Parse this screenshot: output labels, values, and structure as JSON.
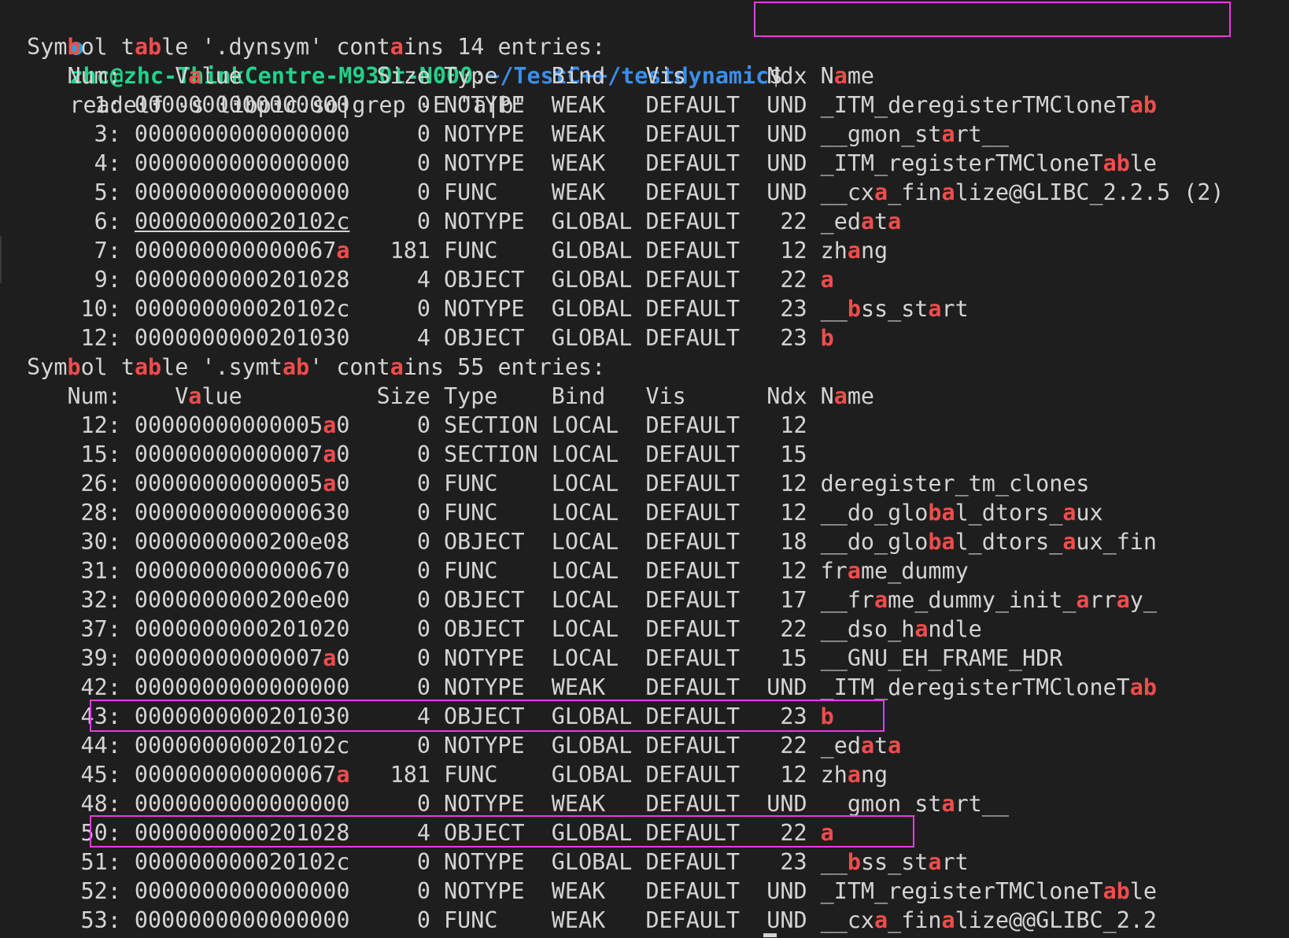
{
  "prompt": {
    "user_host": "zhc@zhc-ThinkCentre-M930t-N000",
    "path": "~/TestC++/testdynamic",
    "symbol": "$",
    "command": "readelf -s libpic.so|grep -E \"a|b\""
  },
  "dynsym": {
    "header": "Symbol table '.dynsym' contains 14 entries:",
    "columns": [
      "Num:",
      "Value",
      "Size",
      "Type",
      "Bind",
      "Vis",
      "Ndx",
      "Name"
    ],
    "rows": [
      [
        "1:",
        "0000000000000000",
        "0",
        "NOTYPE",
        "WEAK",
        "DEFAULT",
        "UND",
        "_ITM_deregisterTMCloneTab"
      ],
      [
        "3:",
        "0000000000000000",
        "0",
        "NOTYPE",
        "WEAK",
        "DEFAULT",
        "UND",
        "__gmon_start__"
      ],
      [
        "4:",
        "0000000000000000",
        "0",
        "NOTYPE",
        "WEAK",
        "DEFAULT",
        "UND",
        "_ITM_registerTMCloneTable"
      ],
      [
        "5:",
        "0000000000000000",
        "0",
        "FUNC",
        "WEAK",
        "DEFAULT",
        "UND",
        "__cxa_finalize@GLIBC_2.2.5 (2)"
      ],
      [
        "6:",
        "000000000020102c",
        "0",
        "NOTYPE",
        "GLOBAL",
        "DEFAULT",
        "22",
        "_edata"
      ],
      [
        "7:",
        "000000000000067a",
        "181",
        "FUNC",
        "GLOBAL",
        "DEFAULT",
        "12",
        "zhang"
      ],
      [
        "9:",
        "0000000000201028",
        "4",
        "OBJECT",
        "GLOBAL",
        "DEFAULT",
        "22",
        "a"
      ],
      [
        "10:",
        "000000000020102c",
        "0",
        "NOTYPE",
        "GLOBAL",
        "DEFAULT",
        "23",
        "__bss_start"
      ],
      [
        "12:",
        "0000000000201030",
        "4",
        "OBJECT",
        "GLOBAL",
        "DEFAULT",
        "23",
        "b"
      ]
    ]
  },
  "symtab": {
    "header": "Symbol table '.symtab' contains 55 entries:",
    "columns": [
      "Num:",
      "Value",
      "Size",
      "Type",
      "Bind",
      "Vis",
      "Ndx",
      "Name"
    ],
    "rows": [
      [
        "12:",
        "00000000000005a0",
        "0",
        "SECTION",
        "LOCAL",
        "DEFAULT",
        "12",
        ""
      ],
      [
        "15:",
        "00000000000007a0",
        "0",
        "SECTION",
        "LOCAL",
        "DEFAULT",
        "15",
        ""
      ],
      [
        "26:",
        "00000000000005a0",
        "0",
        "FUNC",
        "LOCAL",
        "DEFAULT",
        "12",
        "deregister_tm_clones"
      ],
      [
        "28:",
        "0000000000000630",
        "0",
        "FUNC",
        "LOCAL",
        "DEFAULT",
        "12",
        "__do_global_dtors_aux"
      ],
      [
        "30:",
        "0000000000200e08",
        "0",
        "OBJECT",
        "LOCAL",
        "DEFAULT",
        "18",
        "__do_global_dtors_aux_fin"
      ],
      [
        "31:",
        "0000000000000670",
        "0",
        "FUNC",
        "LOCAL",
        "DEFAULT",
        "12",
        "frame_dummy"
      ],
      [
        "32:",
        "0000000000200e00",
        "0",
        "OBJECT",
        "LOCAL",
        "DEFAULT",
        "17",
        "__frame_dummy_init_array_"
      ],
      [
        "37:",
        "0000000000201020",
        "0",
        "OBJECT",
        "LOCAL",
        "DEFAULT",
        "22",
        "__dso_handle"
      ],
      [
        "39:",
        "00000000000007a0",
        "0",
        "NOTYPE",
        "LOCAL",
        "DEFAULT",
        "15",
        "__GNU_EH_FRAME_HDR"
      ],
      [
        "42:",
        "0000000000000000",
        "0",
        "NOTYPE",
        "WEAK",
        "DEFAULT",
        "UND",
        "_ITM_deregisterTMCloneTab"
      ],
      [
        "43:",
        "0000000000201030",
        "4",
        "OBJECT",
        "GLOBAL",
        "DEFAULT",
        "23",
        "b"
      ],
      [
        "44:",
        "000000000020102c",
        "0",
        "NOTYPE",
        "GLOBAL",
        "DEFAULT",
        "22",
        "_edata"
      ],
      [
        "45:",
        "000000000000067a",
        "181",
        "FUNC",
        "GLOBAL",
        "DEFAULT",
        "12",
        "zhang"
      ],
      [
        "48:",
        "0000000000000000",
        "0",
        "NOTYPE",
        "WEAK",
        "DEFAULT",
        "UND",
        "__gmon_start__"
      ],
      [
        "50:",
        "0000000000201028",
        "4",
        "OBJECT",
        "GLOBAL",
        "DEFAULT",
        "22",
        "a"
      ],
      [
        "51:",
        "000000000020102c",
        "0",
        "NOTYPE",
        "GLOBAL",
        "DEFAULT",
        "23",
        "__bss_start"
      ],
      [
        "52:",
        "0000000000000000",
        "0",
        "NOTYPE",
        "WEAK",
        "DEFAULT",
        "UND",
        "_ITM_registerTMCloneTable"
      ],
      [
        "53:",
        "0000000000000000",
        "0",
        "FUNC",
        "WEAK",
        "DEFAULT",
        "UND",
        "__cxa_finalize@@GLIBC_2.2"
      ]
    ]
  },
  "colors": {
    "background": "#1e1e1e",
    "text": "#d4d4d4",
    "match_highlight": "#f14c4c",
    "prompt_user": "#23d18b",
    "prompt_path": "#3b8eea",
    "annotation_box": "#e040e0"
  }
}
